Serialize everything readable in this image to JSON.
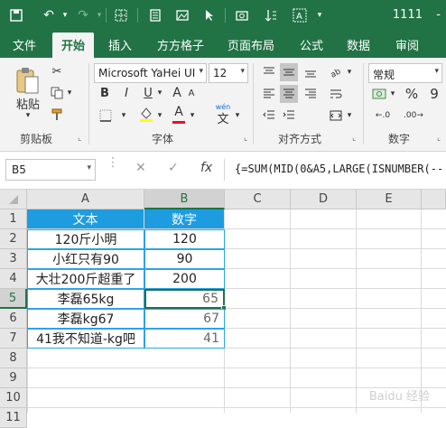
{
  "titlebar": {
    "title": "1111",
    "dash": "-",
    "icons": [
      "save-icon",
      "undo-icon",
      "redo-icon",
      "borders-icon",
      "form-icon",
      "image-icon",
      "cursor-icon",
      "screenshot-icon",
      "sort-icon",
      "text-icon"
    ]
  },
  "tabs": [
    "文件",
    "开始",
    "插入",
    "方方格子",
    "页面布局",
    "公式",
    "数据",
    "审阅"
  ],
  "ribbon": {
    "paste_label": "粘贴",
    "clipboard_label": "剪贴板",
    "font_name": "Microsoft YaHei UI",
    "font_size": "12",
    "font_label": "字体",
    "bold": "B",
    "italic": "I",
    "underline": "U",
    "font_grow": "A",
    "font_shrink": "A",
    "font_color_letter": "A",
    "wen": "wén",
    "wen_char": "文",
    "alignment_label": "对齐方式",
    "number_format": "常规",
    "number_label": "数字",
    "percent": "%",
    "comma": "9"
  },
  "formula_bar": {
    "name_box": "B5",
    "fx": "fx",
    "formula": "{=SUM(MID(0&A5,LARGE(ISNUMBER(--"
  },
  "sheet": {
    "columns": [
      "A",
      "B",
      "C",
      "D",
      "E"
    ],
    "rows": [
      "1",
      "2",
      "3",
      "4",
      "5",
      "6",
      "7",
      "8",
      "9",
      "10",
      "11"
    ],
    "selected_cell": "B5",
    "data": [
      {
        "a": "文本",
        "b": "数字"
      },
      {
        "a": "120斤小明",
        "b": "120"
      },
      {
        "a": "小红只有90",
        "b": "90"
      },
      {
        "a": "大壮200斤超重了",
        "b": "200"
      },
      {
        "a": "李磊65kg",
        "b": "65"
      },
      {
        "a": "李磊kg67",
        "b": "67"
      },
      {
        "a": "41我不知道-kg吧",
        "b": "41"
      }
    ]
  },
  "colors": {
    "excel_green": "#217346",
    "header_blue": "#1e9ce0"
  },
  "watermark": "Baidu 经验"
}
